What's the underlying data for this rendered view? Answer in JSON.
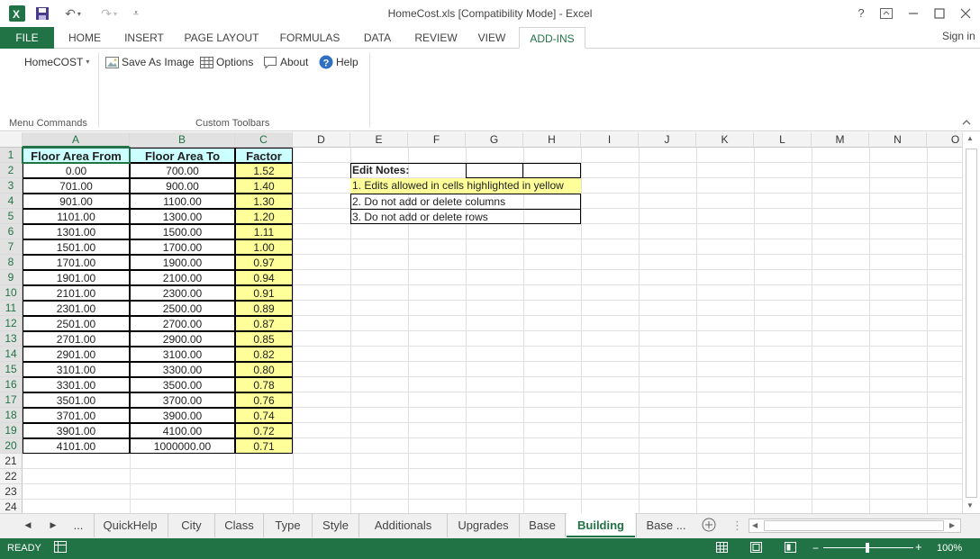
{
  "window": {
    "title": "HomeCost.xls  [Compatibility Mode] - Excel",
    "help": "?",
    "restore": "⬚",
    "minimize": "—",
    "maximize": "☐",
    "close": "✕"
  },
  "qat": {
    "excel_icon": "X",
    "save_icon": "save-icon",
    "undo": "↶",
    "redo": "↷",
    "customize": "⫧"
  },
  "tabs": [
    "FILE",
    "HOME",
    "INSERT",
    "PAGE LAYOUT",
    "FORMULAS",
    "DATA",
    "REVIEW",
    "VIEW",
    "ADD-INS"
  ],
  "signin": "Sign in",
  "ribbon": {
    "homecost": "HomeCOST",
    "save_as_image": "Save As Image",
    "options": "Options",
    "about": "About",
    "help": "Help",
    "group_menu": "Menu Commands",
    "group_custom": "Custom Toolbars"
  },
  "columns": [
    "A",
    "B",
    "C",
    "D",
    "E",
    "F",
    "G",
    "H",
    "I",
    "J",
    "K",
    "L",
    "M",
    "N",
    "O"
  ],
  "rows": [
    "1",
    "2",
    "3",
    "4",
    "5",
    "6",
    "7",
    "8",
    "9",
    "10",
    "11",
    "12",
    "13",
    "14",
    "15",
    "16",
    "17",
    "18",
    "19",
    "20",
    "21",
    "22",
    "23",
    "24"
  ],
  "table": {
    "headers": [
      "Floor Area From",
      "Floor Area To",
      "Factor"
    ],
    "data": [
      [
        "0.00",
        "700.00",
        "1.52"
      ],
      [
        "701.00",
        "900.00",
        "1.40"
      ],
      [
        "901.00",
        "1100.00",
        "1.30"
      ],
      [
        "1101.00",
        "1300.00",
        "1.20"
      ],
      [
        "1301.00",
        "1500.00",
        "1.11"
      ],
      [
        "1501.00",
        "1700.00",
        "1.00"
      ],
      [
        "1701.00",
        "1900.00",
        "0.97"
      ],
      [
        "1901.00",
        "2100.00",
        "0.94"
      ],
      [
        "2101.00",
        "2300.00",
        "0.91"
      ],
      [
        "2301.00",
        "2500.00",
        "0.89"
      ],
      [
        "2501.00",
        "2700.00",
        "0.87"
      ],
      [
        "2701.00",
        "2900.00",
        "0.85"
      ],
      [
        "2901.00",
        "3100.00",
        "0.82"
      ],
      [
        "3101.00",
        "3300.00",
        "0.80"
      ],
      [
        "3301.00",
        "3500.00",
        "0.78"
      ],
      [
        "3501.00",
        "3700.00",
        "0.76"
      ],
      [
        "3701.00",
        "3900.00",
        "0.74"
      ],
      [
        "3901.00",
        "4100.00",
        "0.72"
      ],
      [
        "4101.00",
        "1000000.00",
        "0.71"
      ]
    ]
  },
  "notes": {
    "title": "Edit Notes:",
    "lines": [
      "1. Edits allowed in cells highlighted in yellow",
      "2. Do not add or delete columns",
      "3. Do not add or delete rows"
    ]
  },
  "sheets": [
    "...",
    "QuickHelp",
    "City",
    "Class",
    "Type",
    "Style",
    "Additionals",
    "Upgrades",
    "Base",
    "Building",
    "Base  ..."
  ],
  "sheet_nav": {
    "prev": "◀",
    "next": "▶",
    "add": "+"
  },
  "status": {
    "ready": "READY",
    "zoom": "100%"
  },
  "colors": {
    "accent": "#217346",
    "highlight": "#ffff99",
    "header_cyan": "#ccffff"
  }
}
